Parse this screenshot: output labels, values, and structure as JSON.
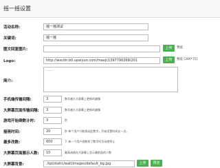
{
  "page": {
    "title": "摇一摇设置"
  },
  "form": {
    "activity_name": {
      "label": "活动名称:",
      "value": "摇一摇测试"
    },
    "keyword": {
      "label": "关键词:",
      "value": "摇一摇"
    },
    "cover_image": {
      "label": "图文回复图片:",
      "value": "",
      "upload_label": "上传",
      "preview_label": "预览"
    },
    "logo": {
      "label": "Logo:",
      "value": "http://wxcdn.b0.upaiyun.com/maxjc1397790268/201",
      "upload_label": "上传",
      "preview_label": "预览 [200*75]"
    },
    "intro": {
      "label": "简介:",
      "placeholder": "——"
    },
    "mobile_interval": {
      "label": "手机端传输间隔:",
      "value": "3",
      "hint": "数字越大大屏幕上更新的越慢"
    },
    "screen_interval": {
      "label": "大屏幕页面传输间隔:",
      "value": "3",
      "hint": "数字越大大屏幕上更新的越慢"
    },
    "countdown": {
      "label": "游戏开始倒数计时:",
      "value": "3",
      "hint": "秒"
    },
    "shake_time": {
      "label": "摇晃时间:",
      "value": "20",
      "hint": "秒 每个用户只能摇动此数字，开始设置时间长一点。"
    },
    "max_people": {
      "label": "最多改数:",
      "value": "600",
      "hint": "下 每一个用户改数到了数字时活动就停止"
    },
    "screen_display_people": {
      "label": "大屏幕页面展示人数:",
      "value": "10",
      "hint": "最高成绩在大屏幕上显示最前面的人数"
    },
    "screen_background": {
      "label": "大屏幕背景:",
      "value": "./tpl/static/wall/images/default_bg.jpg",
      "upload_label": "上传",
      "preview_label": "预览"
    }
  }
}
